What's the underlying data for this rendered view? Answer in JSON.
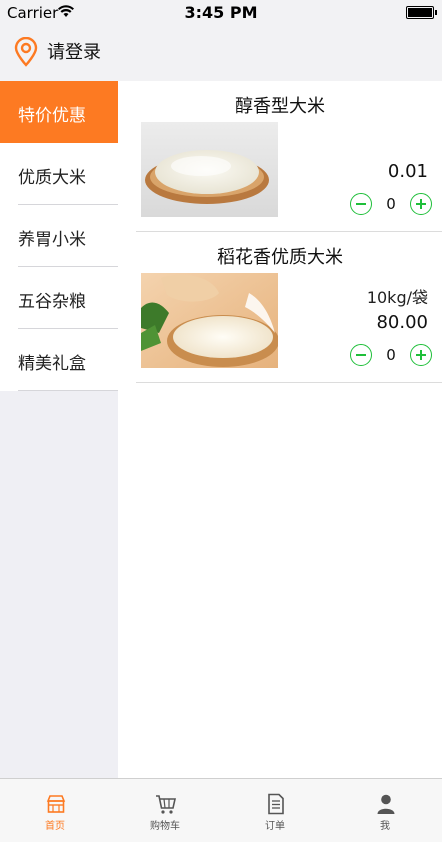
{
  "status_bar": {
    "carrier": "Carrier",
    "time": "3:45 PM"
  },
  "header": {
    "title": "请登录",
    "icon": "location-pin-icon"
  },
  "sidebar": {
    "items": [
      {
        "label": "特价优惠",
        "active": true
      },
      {
        "label": "优质大米",
        "active": false
      },
      {
        "label": "养胃小米",
        "active": false
      },
      {
        "label": "五谷杂粮",
        "active": false
      },
      {
        "label": "精美礼盒",
        "active": false
      }
    ]
  },
  "products": [
    {
      "name": "醇香型大米",
      "spec": "",
      "price": "0.01",
      "quantity": "0"
    },
    {
      "name": "稻花香优质大米",
      "spec": "10kg/袋",
      "price": "80.00",
      "quantity": "0"
    }
  ],
  "tabbar": {
    "tabs": [
      {
        "label": "首页",
        "icon": "home-shop-icon",
        "active": true
      },
      {
        "label": "购物车",
        "icon": "cart-icon",
        "active": false
      },
      {
        "label": "订单",
        "icon": "order-list-icon",
        "active": false
      },
      {
        "label": "我",
        "icon": "user-icon",
        "active": false
      }
    ]
  },
  "colors": {
    "accent": "#fd7a22",
    "stepper": "#1fbf3a",
    "background": "#efeff4"
  }
}
